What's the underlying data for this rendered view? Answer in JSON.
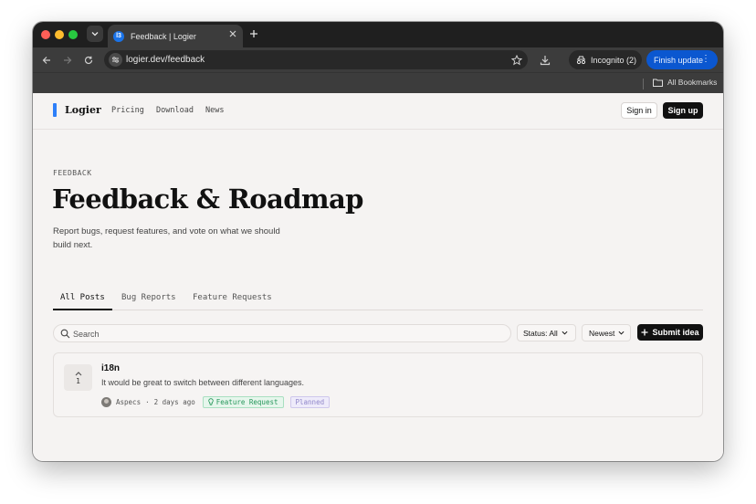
{
  "browser": {
    "tab_title": "Feedback | Logier",
    "favicon_text": "l3",
    "url": "logier.dev/feedback",
    "incognito_label": "Incognito (2)",
    "finish_update_label": "Finish update",
    "all_bookmarks_label": "All Bookmarks"
  },
  "header": {
    "logo": "Logier",
    "nav": [
      "Pricing",
      "Download",
      "News"
    ],
    "sign_in": "Sign in",
    "sign_up": "Sign up"
  },
  "hero": {
    "eyebrow": "FEEDBACK",
    "title": "Feedback & Roadmap",
    "lead": "Report bugs, request features, and vote on what we should build next."
  },
  "filters": {
    "tabs": [
      "All Posts",
      "Bug Reports",
      "Feature Requests"
    ],
    "active_tab": "All Posts",
    "search_placeholder": "Search",
    "status_label": "Status: All",
    "sort_label": "Newest",
    "submit_label": "Submit idea"
  },
  "posts": [
    {
      "votes": "1",
      "title": "i18n",
      "body": "It would be great to switch between different languages.",
      "author": "Aspecs",
      "separator": "·",
      "time": "2 days ago",
      "category": "Feature Request",
      "status": "Planned"
    }
  ],
  "colors": {
    "accent": "#2d7ff9",
    "feature_badge": "#25965a",
    "planned_badge": "#8f86c9",
    "finish_update": "#0b57d0"
  },
  "icons": [
    "chevron-down-icon",
    "close-icon",
    "plus-icon",
    "back-icon",
    "forward-icon",
    "reload-icon",
    "site-settings-icon",
    "star-icon",
    "download-icon",
    "incognito-icon",
    "more-vert-icon",
    "folder-icon",
    "search-icon",
    "chevron-up-icon",
    "lightbulb-icon"
  ]
}
